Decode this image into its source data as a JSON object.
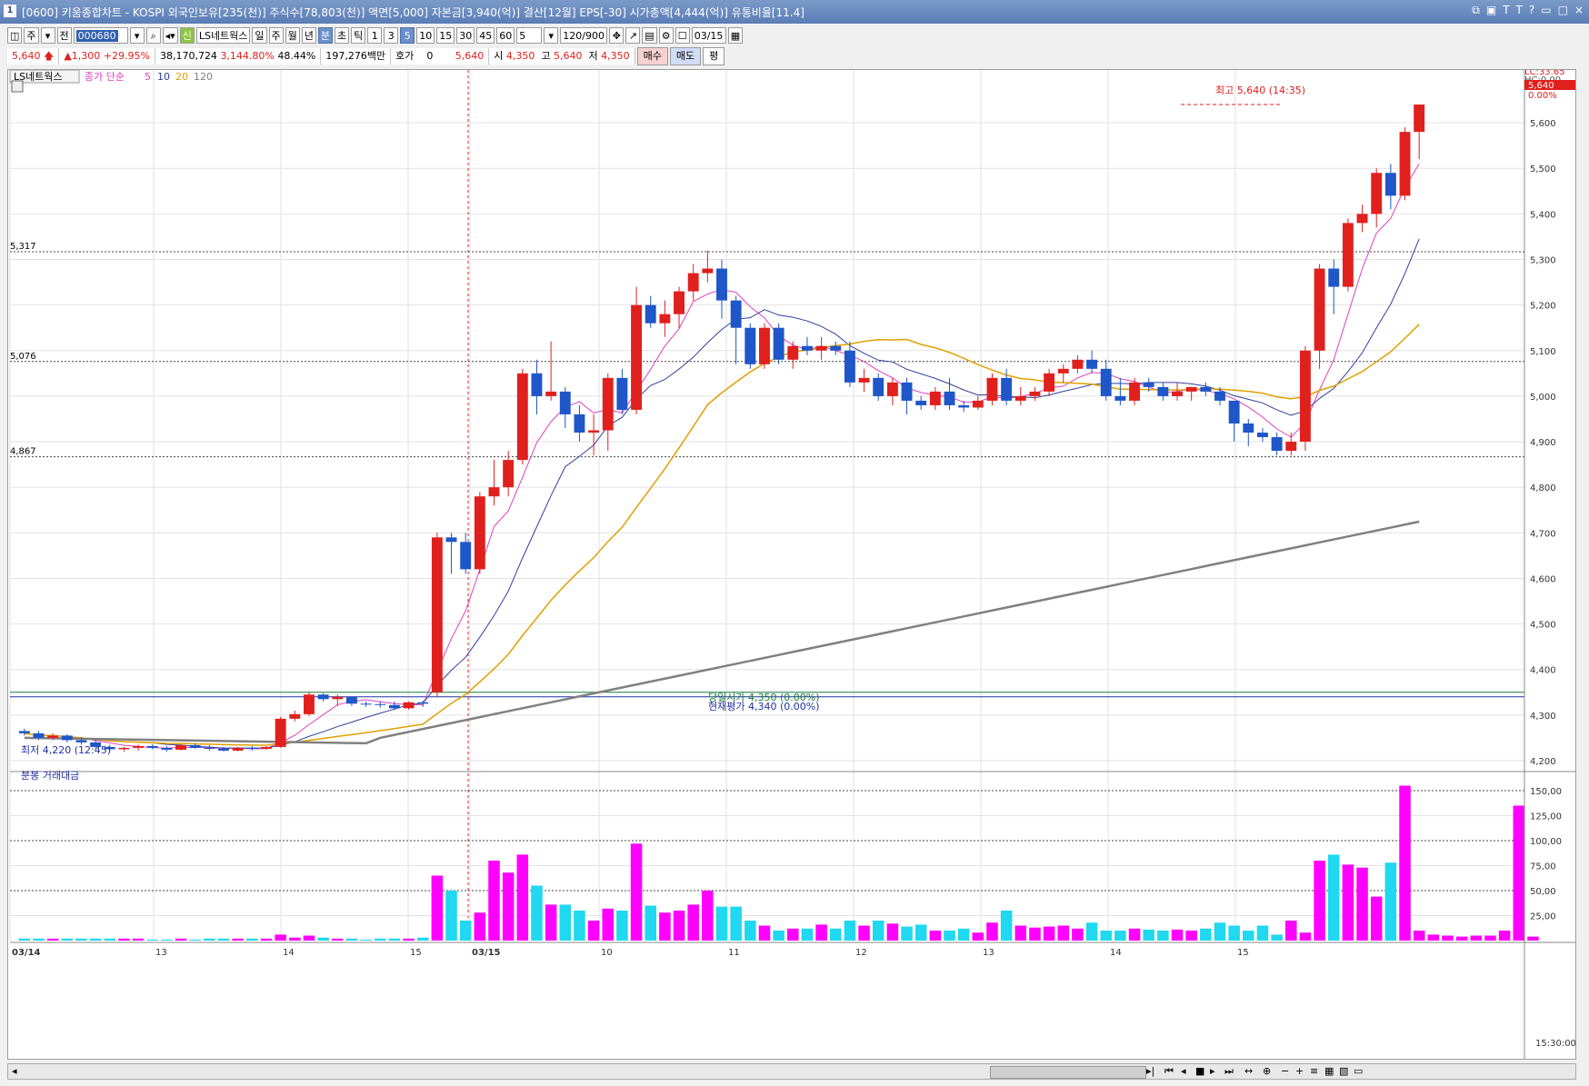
{
  "window": {
    "number": "1",
    "title": "[0600] 키움종합차트 - KOSPI 외국인보유[235(천)] 주식수[78,803(천)] 액면[5,000] 자본금[3,940(억)] 결산[12월] EPS[-30] 시가총액[4,444(억)] 유통비율[11.4]",
    "controls": [
      "⧉",
      "▣",
      "Τ",
      "Τ",
      "?",
      "▭",
      "□",
      "×"
    ]
  },
  "toolbar": {
    "type": "주",
    "mode": "전",
    "code": "000680",
    "stock_name": "LS네트웍스",
    "periods": [
      "일",
      "주",
      "월",
      "년",
      "분",
      "초",
      "틱"
    ],
    "selected_period": "분",
    "intervals": [
      "1",
      "3",
      "5",
      "10",
      "15",
      "30",
      "45",
      "60"
    ],
    "selected_interval": "5",
    "interval_value": "5",
    "count": "120/900",
    "date": "03/15"
  },
  "quote": {
    "price": "5,640",
    "change": "1,300",
    "rate": "+29.95%",
    "volume": "38,170,724",
    "vol_rate": "3,144.80%",
    "turnover": "48.44%",
    "amount": "197,276백만",
    "hoga_label": "호가",
    "hoga_value": "0",
    "hoga_price": "5,640",
    "open_label": "시",
    "open": "4,350",
    "high_label": "고",
    "high": "5,640",
    "low_label": "저",
    "low": "4,350",
    "buy": "매수",
    "sell": "매도",
    "eval": "평"
  },
  "chart": {
    "legend_name": "LS네트웍스",
    "legend_ma": "종가 단순",
    "ma_periods": [
      "5",
      "10",
      "20",
      "120"
    ],
    "ma_colors": [
      "#e040c0",
      "#3040a0",
      "#e0a000",
      "#808080"
    ],
    "corner_lc": "LC:33.65",
    "corner_hc": "HC:0.00",
    "price_tag": "5,640",
    "pct_tag": "0.00%",
    "y_ticks": [
      "5,600",
      "5,500",
      "5,400",
      "5,300",
      "5,200",
      "5,100",
      "5,000",
      "4,900",
      "4,800",
      "4,700",
      "4,600",
      "4,500",
      "4,400",
      "4,300",
      "4,200"
    ],
    "ref_lines": [
      {
        "label": "5,317",
        "value": 5317
      },
      {
        "label": "5,076",
        "value": 5076
      },
      {
        "label": "4,867",
        "value": 4867
      }
    ],
    "high_note": "최고 5,640 (14:35)",
    "low_note": "최저 4,220 (12:45)",
    "prev_close_note": "당일시가 4,350 (0.00%)",
    "current_note": "현재평가 4,340 (0.00%)",
    "volume_title": "분봉 거래대금",
    "volume_ticks": [
      "150,00",
      "125,00",
      "100,00",
      "75,00",
      "50,00",
      "25,00"
    ],
    "x_labels": [
      "03/14",
      "13",
      "14",
      "15",
      "03/15",
      "10",
      "11",
      "12",
      "13",
      "14",
      "15"
    ],
    "time_label": "15:30:00"
  },
  "chart_data": {
    "type": "candlestick",
    "ylim": [
      4180,
      5680
    ],
    "volume_ylim": [
      0,
      160
    ],
    "candles": [
      [
        4265,
        4270,
        4255,
        4260
      ],
      [
        4260,
        4265,
        4245,
        4250
      ],
      [
        4250,
        4260,
        4245,
        4255
      ],
      [
        4255,
        4258,
        4240,
        4245
      ],
      [
        4245,
        4250,
        4235,
        4240
      ],
      [
        4240,
        4245,
        4225,
        4230
      ],
      [
        4230,
        4235,
        4220,
        4225
      ],
      [
        4225,
        4230,
        4220,
        4228
      ],
      [
        4228,
        4235,
        4222,
        4232
      ],
      [
        4232,
        4236,
        4225,
        4228
      ],
      [
        4228,
        4232,
        4220,
        4224
      ],
      [
        4224,
        4236,
        4222,
        4234
      ],
      [
        4234,
        4238,
        4226,
        4228
      ],
      [
        4228,
        4234,
        4222,
        4226
      ],
      [
        4226,
        4230,
        4220,
        4222
      ],
      [
        4222,
        4230,
        4220,
        4228
      ],
      [
        4228,
        4232,
        4222,
        4226
      ],
      [
        4226,
        4232,
        4224,
        4230
      ],
      [
        4230,
        4296,
        4228,
        4292
      ],
      [
        4292,
        4310,
        4286,
        4302
      ],
      [
        4302,
        4350,
        4298,
        4345
      ],
      [
        4345,
        4348,
        4330,
        4335
      ],
      [
        4335,
        4345,
        4320,
        4340
      ],
      [
        4340,
        4342,
        4320,
        4325
      ],
      [
        4325,
        4330,
        4318,
        4324
      ],
      [
        4324,
        4330,
        4316,
        4322
      ],
      [
        4322,
        4330,
        4312,
        4315
      ],
      [
        4315,
        4330,
        4312,
        4328
      ],
      [
        4328,
        4332,
        4318,
        4325
      ],
      [
        4350,
        4700,
        4340,
        4690
      ],
      [
        4690,
        4700,
        4610,
        4680
      ],
      [
        4680,
        4700,
        4610,
        4620
      ],
      [
        4620,
        4790,
        4610,
        4780
      ],
      [
        4780,
        4860,
        4760,
        4800
      ],
      [
        4800,
        4880,
        4780,
        4860
      ],
      [
        4860,
        5060,
        4850,
        5050
      ],
      [
        5050,
        5080,
        4960,
        5000
      ],
      [
        5000,
        5120,
        4990,
        5010
      ],
      [
        5010,
        5020,
        4930,
        4960
      ],
      [
        4960,
        4980,
        4900,
        4920
      ],
      [
        4920,
        4960,
        4870,
        4925
      ],
      [
        4925,
        5050,
        4880,
        5040
      ],
      [
        5040,
        5060,
        4960,
        4970
      ],
      [
        4970,
        5240,
        4960,
        5200
      ],
      [
        5200,
        5220,
        5150,
        5160
      ],
      [
        5160,
        5210,
        5130,
        5180
      ],
      [
        5180,
        5240,
        5150,
        5230
      ],
      [
        5230,
        5290,
        5210,
        5270
      ],
      [
        5270,
        5320,
        5250,
        5280
      ],
      [
        5280,
        5300,
        5170,
        5210
      ],
      [
        5210,
        5220,
        5070,
        5150
      ],
      [
        5150,
        5160,
        5060,
        5070
      ],
      [
        5070,
        5160,
        5060,
        5150
      ],
      [
        5150,
        5160,
        5070,
        5080
      ],
      [
        5080,
        5120,
        5060,
        5110
      ],
      [
        5110,
        5130,
        5090,
        5100
      ],
      [
        5100,
        5130,
        5080,
        5110
      ],
      [
        5110,
        5120,
        5090,
        5100
      ],
      [
        5100,
        5120,
        5020,
        5030
      ],
      [
        5030,
        5060,
        5010,
        5040
      ],
      [
        5040,
        5050,
        4990,
        5000
      ],
      [
        5000,
        5040,
        4980,
        5030
      ],
      [
        5030,
        5040,
        4960,
        4990
      ],
      [
        4990,
        5000,
        4970,
        4980
      ],
      [
        4980,
        5020,
        4970,
        5010
      ],
      [
        5010,
        5040,
        4970,
        4980
      ],
      [
        4980,
        4990,
        4965,
        4975
      ],
      [
        4975,
        5000,
        4970,
        4990
      ],
      [
        4990,
        5050,
        4980,
        5040
      ],
      [
        5040,
        5060,
        4980,
        4990
      ],
      [
        4990,
        5020,
        4980,
        5000
      ],
      [
        5000,
        5020,
        4990,
        5010
      ],
      [
        5010,
        5060,
        5000,
        5050
      ],
      [
        5050,
        5070,
        5030,
        5060
      ],
      [
        5060,
        5090,
        5050,
        5080
      ],
      [
        5080,
        5100,
        5050,
        5060
      ],
      [
        5060,
        5080,
        4990,
        5000
      ],
      [
        5000,
        5040,
        4980,
        4990
      ],
      [
        4990,
        5040,
        4980,
        5030
      ],
      [
        5030,
        5040,
        5010,
        5020
      ],
      [
        5020,
        5030,
        4990,
        5000
      ],
      [
        5000,
        5030,
        4990,
        5010
      ],
      [
        5010,
        5020,
        4990,
        5020
      ],
      [
        5020,
        5030,
        5000,
        5010
      ],
      [
        5010,
        5020,
        4980,
        4990
      ],
      [
        4990,
        4990,
        4900,
        4940
      ],
      [
        4940,
        4950,
        4890,
        4920
      ],
      [
        4920,
        4930,
        4900,
        4910
      ],
      [
        4910,
        4920,
        4870,
        4880
      ],
      [
        4880,
        4920,
        4870,
        4900
      ],
      [
        4900,
        5110,
        4880,
        5100
      ],
      [
        5100,
        5290,
        5060,
        5280
      ],
      [
        5280,
        5300,
        5180,
        5240
      ],
      [
        5240,
        5390,
        5230,
        5380
      ],
      [
        5380,
        5420,
        5360,
        5400
      ],
      [
        5400,
        5500,
        5370,
        5490
      ],
      [
        5490,
        5510,
        5410,
        5440
      ],
      [
        5440,
        5590,
        5430,
        5580
      ],
      [
        5580,
        5640,
        5520,
        5640
      ]
    ],
    "volume": [
      2,
      2,
      2,
      2,
      2,
      2,
      2,
      2,
      2,
      1,
      1,
      2,
      1,
      2,
      2,
      2,
      2,
      2,
      6,
      3,
      5,
      3,
      2,
      2,
      1,
      2,
      2,
      2,
      3,
      65,
      50,
      20,
      28,
      80,
      68,
      86,
      55,
      36,
      36,
      30,
      20,
      32,
      30,
      97,
      35,
      28,
      30,
      36,
      50,
      34,
      34,
      20,
      15,
      10,
      12,
      12,
      16,
      12,
      20,
      15,
      20,
      17,
      14,
      16,
      10,
      10,
      12,
      8,
      18,
      30,
      15,
      13,
      14,
      15,
      12,
      18,
      10,
      10,
      12,
      11,
      10,
      11,
      10,
      12,
      18,
      15,
      10,
      15,
      6,
      20,
      8,
      80,
      86,
      76,
      73,
      44,
      78,
      155,
      10,
      6,
      5,
      4,
      5,
      5,
      10,
      135,
      4
    ],
    "volume_colors": "magenta-up/cyan-down"
  }
}
